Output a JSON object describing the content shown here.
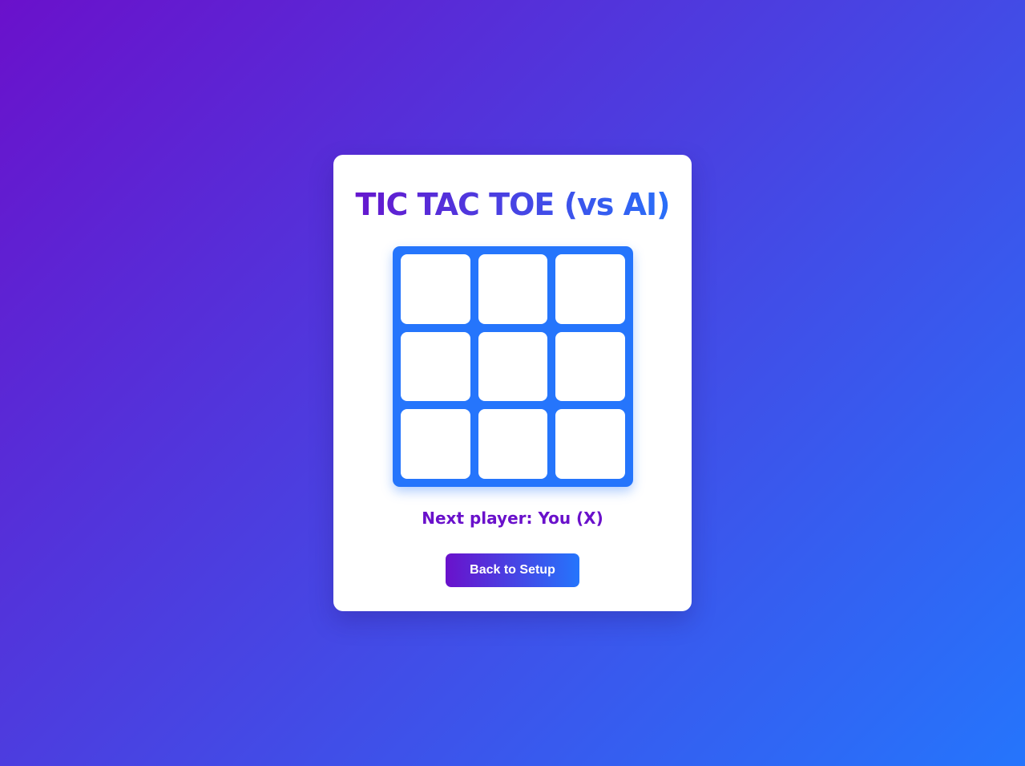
{
  "title": "TIC TAC TOE (vs AI)",
  "board": {
    "cells": [
      "",
      "",
      "",
      "",
      "",
      "",
      "",
      "",
      ""
    ]
  },
  "status": "Next player: You (X)",
  "buttons": {
    "back_label": "Back to Setup"
  },
  "colors": {
    "gradient_start": "#6a11cb",
    "gradient_end": "#2575fc",
    "card_background": "#ffffff",
    "board_background": "#2575fc"
  }
}
